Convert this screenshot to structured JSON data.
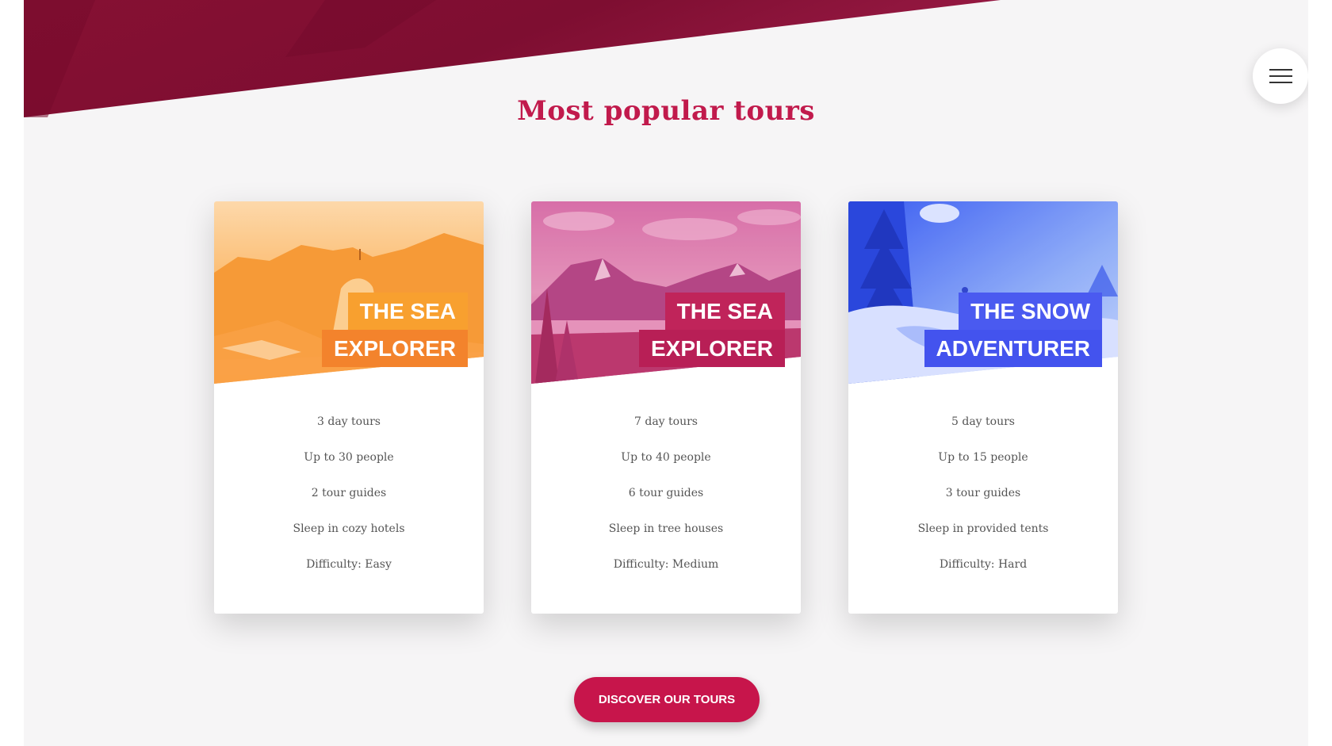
{
  "colors": {
    "accent": "#c11a4c",
    "button": "#c7154b",
    "page_background": "#f6f5f6",
    "header_band": "#8a1035"
  },
  "header": {
    "menu_icon": "hamburger-menu-icon"
  },
  "section": {
    "title": "Most popular tours"
  },
  "tours": [
    {
      "heading": [
        "THE SEA",
        "EXPLORER"
      ],
      "theme": "orange",
      "details": [
        "3 day tours",
        "Up to 30 people",
        "2 tour guides",
        "Sleep in cozy hotels",
        "Difficulty: Easy"
      ]
    },
    {
      "heading": [
        "THE SEA",
        "EXPLORER"
      ],
      "theme": "magenta",
      "details": [
        "7 day tours",
        "Up to 40 people",
        "6 tour guides",
        "Sleep in tree houses",
        "Difficulty: Medium"
      ]
    },
    {
      "heading": [
        "THE SNOW",
        "ADVENTURER"
      ],
      "theme": "blue",
      "details": [
        "5 day tours",
        "Up to 15 people",
        "3 tour guides",
        "Sleep in provided tents",
        "Difficulty: Hard"
      ]
    }
  ],
  "cta": {
    "label": "DISCOVER OUR TOURS"
  }
}
